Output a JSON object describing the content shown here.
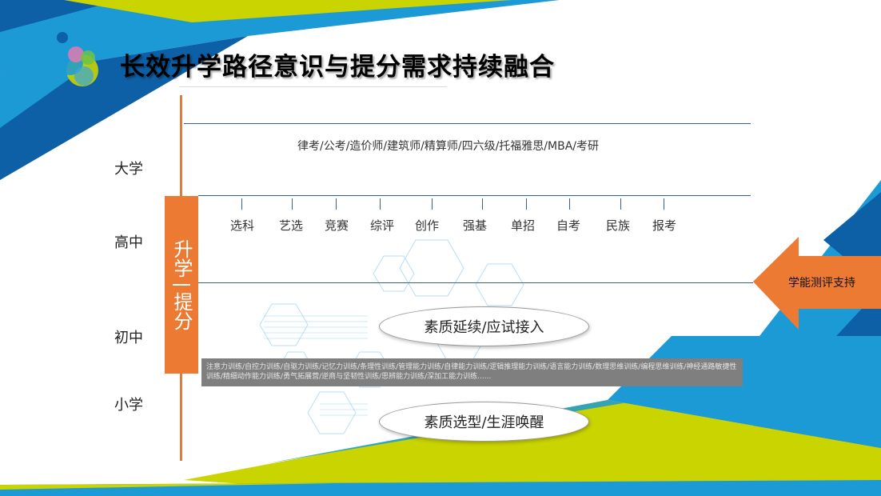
{
  "title": "长效升学路径意识与提分需求持续融合",
  "levels": {
    "university": "大学",
    "high_school": "高中",
    "middle_school": "初中",
    "primary_school": "小学"
  },
  "university_options": "律考/公考/造价师/建筑师/精算师/四六级/托福雅思/MBA/考研",
  "high_school_items": [
    "选科",
    "艺选",
    "竞赛",
    "综评",
    "创作",
    "强基",
    "单招",
    "自考",
    "民族",
    "报考"
  ],
  "upgrade_box": {
    "top": "升学",
    "bottom": "提分"
  },
  "assessment_arrow": "学能测评支持",
  "middle_school_ellipse": "素质延续/应试接入",
  "primary_school_ellipse": "素质选型/生涯唤醒",
  "training_list": "注意力训练/自控力训练/自驱力训练/记忆力训练/条理性训练/管理能力训练/自律能力训练/逻辑推理能力训练/语言能力训练/数理思维训练/编程思维训练/神经通路敏捷性训练/精细动作能力训练/勇气拓展营/逆商与坚韧性训练/思辨能力训练/深加工能力训练......",
  "colors": {
    "orange": "#ec7a33",
    "blue": "#1b9ad6",
    "dark_blue": "#0d5fa6",
    "lime": "#c9d400",
    "line": "#3a5f8a"
  }
}
